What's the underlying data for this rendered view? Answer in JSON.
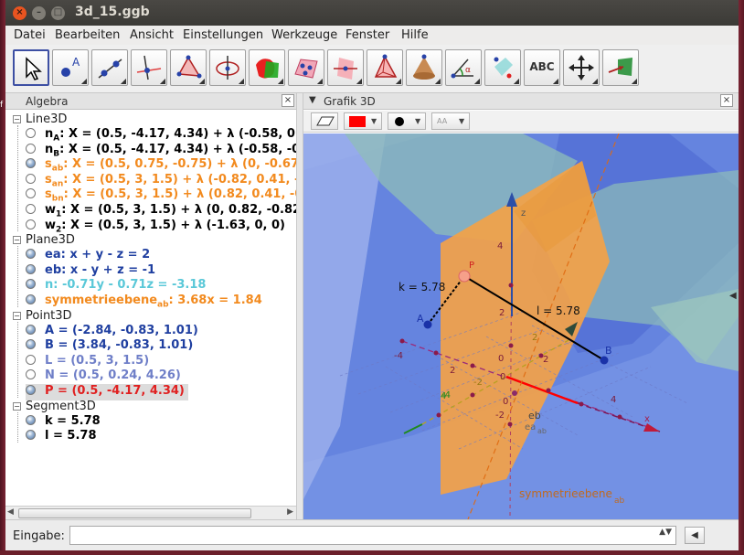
{
  "window": {
    "title": "3d_15.ggb",
    "close_glyph": "×",
    "min_glyph": "–",
    "max_glyph": "□"
  },
  "menu": [
    "Datei",
    "Bearbeiten",
    "Ansicht",
    "Einstellungen",
    "Werkzeuge",
    "Fenster",
    "Hilfe"
  ],
  "toolbar": {
    "text_tool_label": "ABC",
    "help_glyph": "?",
    "gear_glyph": "⚙"
  },
  "algebra": {
    "title": "Algebra",
    "close_glyph": "×",
    "categories": [
      {
        "name": "Line3D",
        "items": [
          {
            "label": "n",
            "sub": "A",
            "expr": ": X = (0.5, -4.17, 4.34) + λ (-0.58, 0.5",
            "color": "#000000",
            "shown": false
          },
          {
            "label": "n",
            "sub": "B",
            "expr": ": X = (0.5, -4.17, 4.34) + λ (-0.58, -0.5",
            "color": "#000000",
            "shown": false
          },
          {
            "label": "s",
            "sub": "ab",
            "expr": ": X = (0.5, 0.75, -0.75) + λ (0, -0.67,",
            "color": "#f28a1e",
            "shown": true
          },
          {
            "label": "s",
            "sub": "an",
            "expr": ": X = (0.5, 3, 1.5) + λ (-0.82, 0.41, -0",
            "color": "#f28a1e",
            "shown": false
          },
          {
            "label": "s",
            "sub": "bn",
            "expr": ": X = (0.5, 3, 1.5) + λ (0.82, 0.41, -0.",
            "color": "#f28a1e",
            "shown": false
          },
          {
            "label": "w",
            "sub": "1",
            "expr": ": X = (0.5, 3, 1.5) + λ (0, 0.82, -0.82)",
            "color": "#000000",
            "shown": false
          },
          {
            "label": "w",
            "sub": "2",
            "expr": ": X = (0.5, 3, 1.5) + λ (-1.63, 0, 0)",
            "color": "#000000",
            "shown": false
          }
        ]
      },
      {
        "name": "Plane3D",
        "items": [
          {
            "label": "ea",
            "sub": "",
            "expr": ": x + y - z = 2",
            "color": "#1f3fa0",
            "shown": true
          },
          {
            "label": "eb",
            "sub": "",
            "expr": ": x - y + z = -1",
            "color": "#1f3fa0",
            "shown": true
          },
          {
            "label": "n",
            "sub": "",
            "expr": ": -0.71y - 0.71z = -3.18",
            "color": "#5ac8d8",
            "shown": true
          },
          {
            "label": "symmetrieebene",
            "sub": "ab",
            "expr": ": 3.68x = 1.84",
            "color": "#f28a1e",
            "shown": true
          }
        ]
      },
      {
        "name": "Point3D",
        "items": [
          {
            "label": "A",
            "sub": "",
            "expr": " = (-2.84, -0.83, 1.01)",
            "color": "#1f3fa0",
            "shown": true
          },
          {
            "label": "B",
            "sub": "",
            "expr": " = (3.84, -0.83, 1.01)",
            "color": "#1f3fa0",
            "shown": true
          },
          {
            "label": "L",
            "sub": "",
            "expr": " = (0.5, 3, 1.5)",
            "color": "#6f7fc8",
            "shown": false
          },
          {
            "label": "N",
            "sub": "",
            "expr": " = (0.5, 0.24, 4.26)",
            "color": "#6f7fc8",
            "shown": false
          },
          {
            "label": "P",
            "sub": "",
            "expr": " = (0.5, -4.17, 4.34)",
            "color": "#e02020",
            "shown": true,
            "selected": true
          }
        ]
      },
      {
        "name": "Segment3D",
        "items": [
          {
            "label": "k",
            "sub": "",
            "expr": " = 5.78",
            "color": "#000000",
            "shown": true
          },
          {
            "label": "l",
            "sub": "",
            "expr": " = 5.78",
            "color": "#000000",
            "shown": true
          }
        ]
      }
    ]
  },
  "graphics": {
    "title": "Grafik 3D",
    "close_glyph": "×",
    "line_color": "#ff0000",
    "labels": {
      "k": "k = 5.78",
      "l": "l = 5.78",
      "A": "A",
      "B": "B",
      "P": "P",
      "z": "z",
      "x": "x",
      "eb": "eb",
      "ea": "ea",
      "ea_sub": "ab",
      "sym": "symmetrieebene",
      "sym_sub": "ab",
      "ticks": [
        "4",
        "2",
        "0",
        "-2",
        "-4",
        "2",
        "4",
        "2",
        "4",
        "-2",
        "-4",
        "0",
        "0",
        "2"
      ]
    }
  },
  "input": {
    "label": "Eingabe:",
    "value": "",
    "updown": "▲▼",
    "btn_glyph": "◀"
  }
}
